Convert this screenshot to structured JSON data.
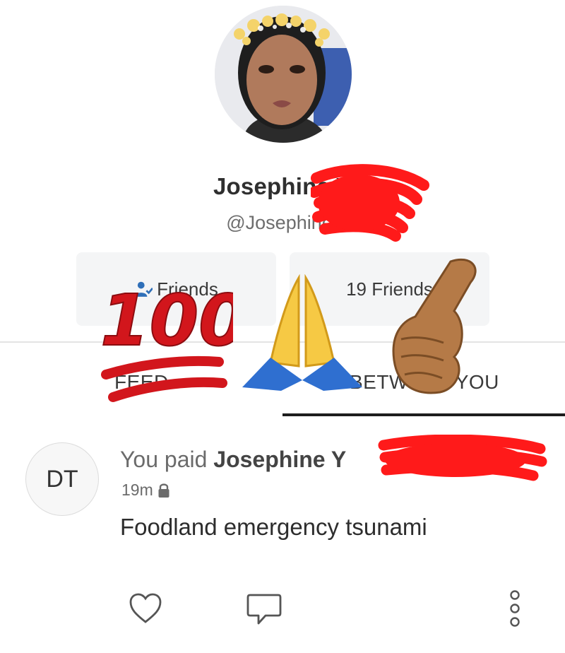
{
  "profile": {
    "name": "Josephine Y",
    "handle": "@Josephine-"
  },
  "friends": {
    "left_label": "Friends",
    "right_label": "19 Friends"
  },
  "tabs": {
    "feed": "FEED",
    "between": "BETWEEN YOU"
  },
  "transaction": {
    "avatar_initials": "DT",
    "prefix": "You paid ",
    "recipient": "Josephine Y",
    "time": "19m",
    "note": "Foodland emergency tsunami"
  },
  "icons": [
    "person-icon",
    "lock-icon",
    "heart-icon",
    "comment-icon",
    "more-icon"
  ],
  "overlays": [
    "hundred-points-emoji",
    "praying-hands-emoji",
    "call-me-hand-emoji"
  ]
}
